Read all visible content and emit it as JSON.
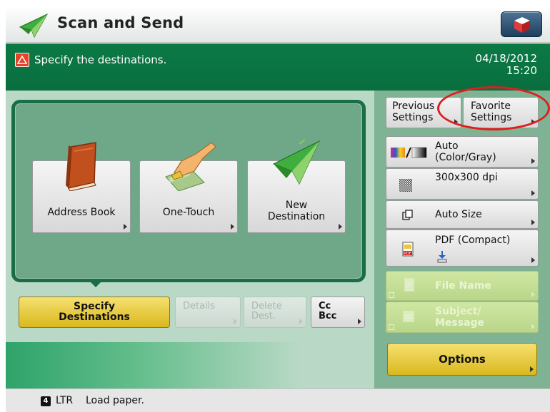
{
  "header": {
    "title": "Scan and Send",
    "logo_icon": "paper-plane-icon",
    "right_button_icon": "cube-icon"
  },
  "status": {
    "message": "Specify the destinations.",
    "date": "04/18/2012",
    "time": "15:20",
    "warning_icon": "warning-icon"
  },
  "destinations": {
    "address_book": "Address Book",
    "one_touch": "One-Touch",
    "new_dest_line1": "New",
    "new_dest_line2": "Destination"
  },
  "lower_buttons": {
    "specify_line1": "Specify",
    "specify_line2": "Destinations",
    "details": "Details",
    "delete_line1": "Delete",
    "delete_line2": "Dest.",
    "cc_line1": "Cc",
    "cc_line2": "Bcc"
  },
  "settings": {
    "previous_line1": "Previous",
    "previous_line2": "Settings",
    "favorite_line1": "Favorite",
    "favorite_line2": "Settings",
    "color_line1": "Auto",
    "color_line2": "(Color/Gray)",
    "resolution": "300x300 dpi",
    "size": "Auto Size",
    "format": "PDF (Compact)",
    "file_name": "File Name",
    "subject_line1": "Subject/",
    "subject_line2": "Message",
    "options": "Options"
  },
  "footer": {
    "paper_number": "4",
    "paper_size": "LTR",
    "message": "Load paper."
  },
  "colors": {
    "accent_green": "#0b7a45",
    "panel_green": "#7fb394",
    "yellow_button": "#d9b81e",
    "highlight_red": "#e01e1e"
  }
}
